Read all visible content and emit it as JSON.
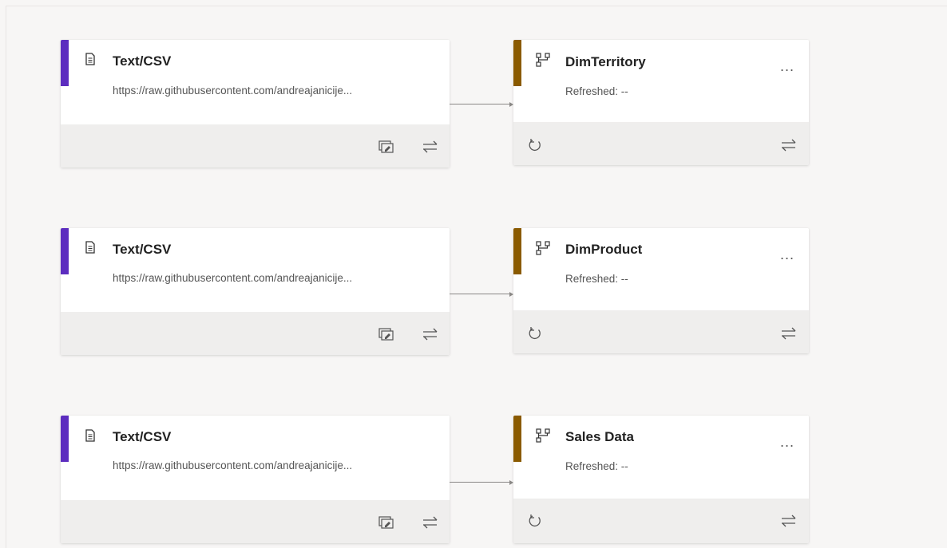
{
  "colors": {
    "source_accent": "#5c2dbf",
    "query_accent": "#8a5a00",
    "canvas": "#f7f6f5",
    "footer": "#efeeed"
  },
  "sources": [
    {
      "title": "Text/CSV",
      "url": "https://raw.githubusercontent.com/andreajanicije...",
      "icon": "document-icon"
    },
    {
      "title": "Text/CSV",
      "url": "https://raw.githubusercontent.com/andreajanicije...",
      "icon": "document-icon"
    },
    {
      "title": "Text/CSV",
      "url": "https://raw.githubusercontent.com/andreajanicije...",
      "icon": "document-icon"
    }
  ],
  "queries": [
    {
      "title": "DimTerritory",
      "refreshed": "Refreshed: --",
      "more": "...",
      "icon": "query-step-icon"
    },
    {
      "title": "DimProduct",
      "refreshed": "Refreshed: --",
      "more": "...",
      "icon": "query-step-icon"
    },
    {
      "title": "Sales Data",
      "refreshed": "Refreshed: --",
      "more": "...",
      "icon": "query-step-icon"
    }
  ],
  "footer_icons": {
    "source": [
      "edit-settings-icon",
      "transform-arrows-icon"
    ],
    "query": [
      "refresh-icon",
      "transform-arrows-icon"
    ]
  }
}
